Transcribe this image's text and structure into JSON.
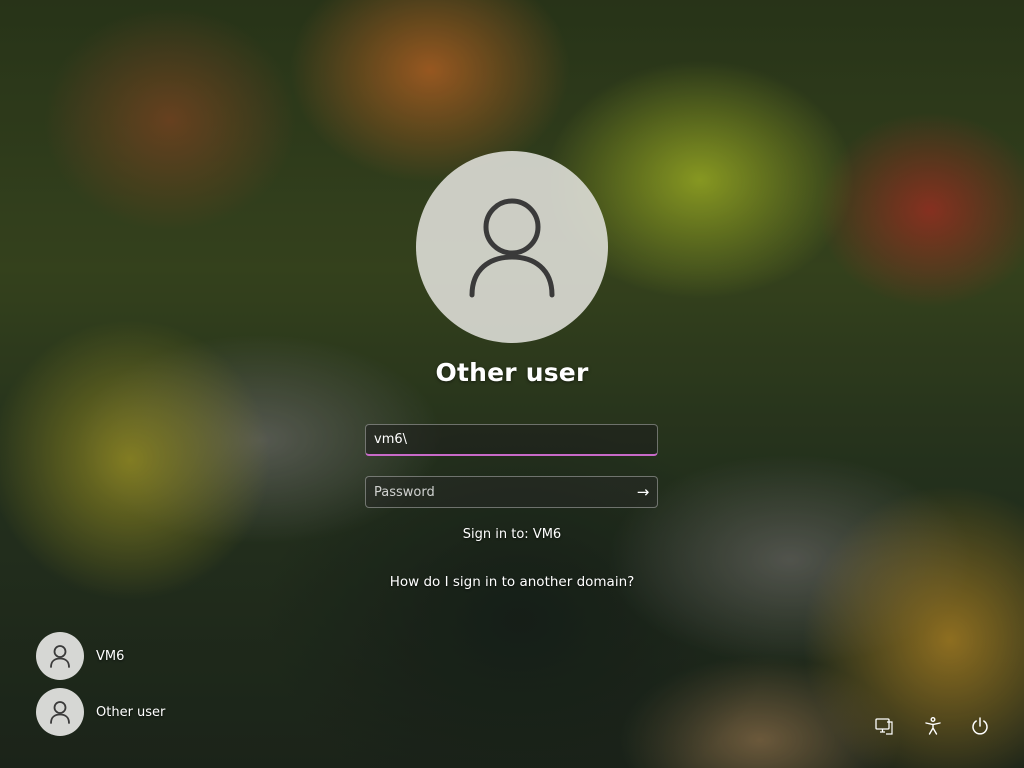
{
  "login": {
    "user_title": "Other user",
    "username": {
      "value": "vm6\\",
      "placeholder": ""
    },
    "password": {
      "value": "",
      "placeholder": "Password"
    },
    "submit_glyph": "→",
    "sign_in_to": "Sign in to: VM6",
    "domain_help_link": "How do I sign in to another domain?"
  },
  "user_list": [
    {
      "name": "VM6",
      "icon": "user-icon"
    },
    {
      "name": "Other user",
      "icon": "user-icon"
    }
  ],
  "system_icons": [
    {
      "name": "network-icon"
    },
    {
      "name": "accessibility-icon"
    },
    {
      "name": "power-icon"
    }
  ],
  "colors": {
    "input_focus_underline": "#c86ac8",
    "text": "#ffffff",
    "avatar_bg": "#e1e1dc"
  }
}
